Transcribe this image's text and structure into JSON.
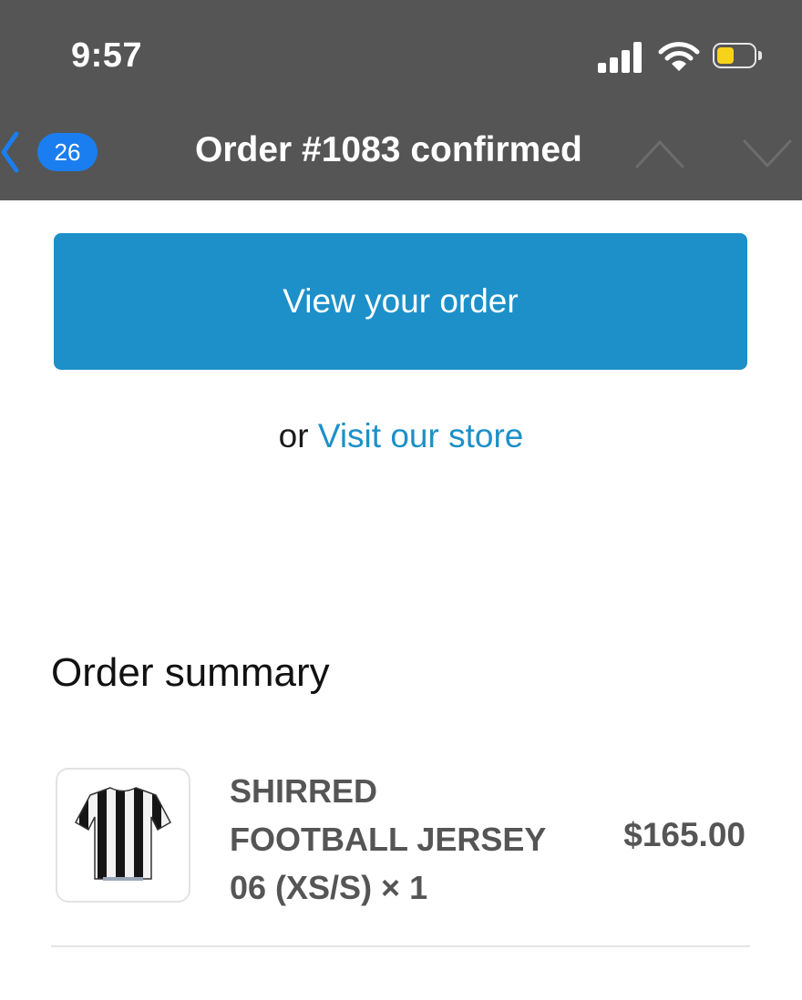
{
  "status_bar": {
    "time": "9:57"
  },
  "nav": {
    "badge_count": "26",
    "title": "Order #1083 confirmed"
  },
  "actions": {
    "view_order_label": "View your order",
    "or_text": "or",
    "visit_store_label": "Visit our store"
  },
  "order_summary": {
    "heading": "Order summary",
    "items": [
      {
        "name_lines": [
          "SHIRRED",
          "FOOTBALL JERSEY",
          "06 (XS/S) × 1"
        ],
        "price": "$165.00"
      }
    ]
  },
  "colors": {
    "chrome": "#555555",
    "accent": "#1d90c9",
    "badge": "#1a7ef0",
    "battery": "#f6d21b"
  },
  "icons": [
    "signal-icon",
    "wifi-icon",
    "battery-icon",
    "back-chevron-icon",
    "chevron-up-icon",
    "chevron-down-icon",
    "jersey-image"
  ]
}
